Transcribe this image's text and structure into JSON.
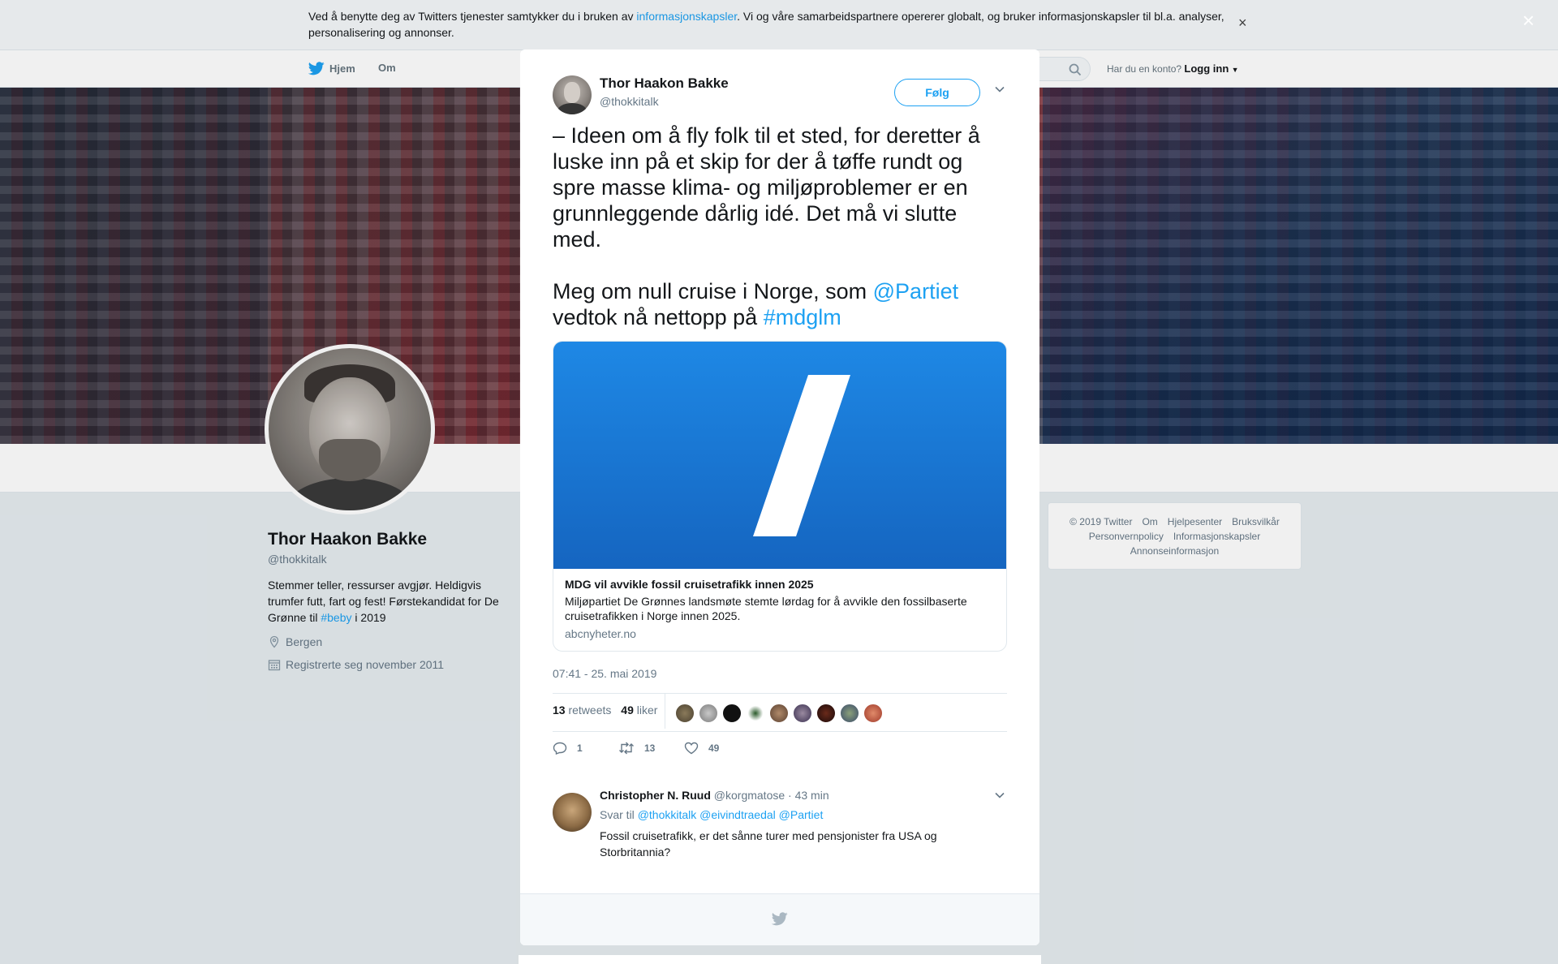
{
  "cookie": {
    "text_before": "Ved å benytte deg av Twitters tjenester samtykker du i bruken av ",
    "link": "informasjonskapsler",
    "text_after": ". Vi og våre samarbeidspartnere opererer globalt, og bruker informasjonskapsler til bl.a. analyser, personalisering og annonser.",
    "close": "×"
  },
  "nav": {
    "home": "Hjem",
    "about": "Om",
    "account_prompt": "Har du en konto?",
    "login": "Logg inn"
  },
  "overlay_close": "×",
  "profile": {
    "name": "Thor Haakon Bakke",
    "handle": "@thokkitalk",
    "bio_1": "Stemmer teller, ressurser avgjør. Heldigvis trumfer futt, fart og fest! Førstekandidat for De Grønne til ",
    "bio_tag": "#beby",
    "bio_2": " i 2019",
    "location": "Bergen",
    "joined": "Registrerte seg november 2011"
  },
  "footer": {
    "links_row1": [
      "© 2019 Twitter",
      "Om",
      "Hjelpesenter",
      "Bruksvilkår"
    ],
    "links_row2": [
      "Personvernpolicy",
      "Informasjonskapsler"
    ],
    "links_row3": [
      "Annonseinformasjon"
    ]
  },
  "tweet": {
    "name": "Thor Haakon Bakke",
    "handle": "@thokkitalk",
    "follow": "Følg",
    "text_1": "– Ideen om å fly folk til et sted, for deretter å luske inn på et skip for der å tøffe rundt og spre masse klima- og miljøproblemer er en grunnleggende dårlig idé. Det må vi slutte med.\n\nMeg om null cruise i Norge, som ",
    "mention": "@Partiet",
    "text_2": "\nvedtok nå nettopp på ",
    "hashtag": "#mdglm",
    "card": {
      "title": "MDG vil avvikle fossil cruisetrafikk innen 2025",
      "description": "Miljøpartiet De Grønnes landsmøte stemte lørdag for å avvikle den fossilbaserte cruisetrafikken i Norge innen 2025.",
      "domain": "abcnyheter.no"
    },
    "timestamp": "07:41 - 25. mai 2019",
    "retweets_count": "13",
    "retweets_label": "retweets",
    "likes_count": "49",
    "likes_label": "liker",
    "actions": {
      "replies": "1",
      "retweets": "13",
      "likes": "49"
    }
  },
  "reply": {
    "name": "Christopher N. Ruud",
    "handle": "@korgmatose",
    "time": "· 43 min",
    "reply_prefix": "Svar til",
    "mentions": [
      "@thokkitalk",
      "@eivindtraedal",
      "@Partiet"
    ],
    "text": "Fossil cruisetrafikk, er det sånne turer med pensjonister fra USA og Storbritannia?"
  },
  "colors": {
    "accent": "#1da1f2",
    "card_blue": "#1e88e5",
    "text": "#14171a",
    "muted": "#657786"
  }
}
